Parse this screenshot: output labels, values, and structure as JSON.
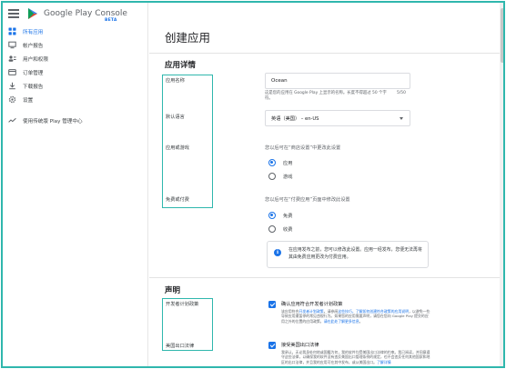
{
  "sidebar": {
    "brand": "Google Play Console",
    "beta": "BETA",
    "items": [
      {
        "label": "所有应用",
        "icon": "apps-icon",
        "active": true
      },
      {
        "label": "帐户报告",
        "icon": "monitor-icon",
        "active": false
      },
      {
        "label": "用户和权限",
        "icon": "users-icon",
        "active": false
      },
      {
        "label": "订单管理",
        "icon": "card-icon",
        "active": false
      },
      {
        "label": "下载报告",
        "icon": "download-icon",
        "active": false
      },
      {
        "label": "设置",
        "icon": "gear-icon",
        "active": false
      },
      {
        "label": "使用传统版 Play 管理中心",
        "icon": "trend-icon",
        "active": false
      }
    ]
  },
  "page": {
    "title": "创建应用"
  },
  "details": {
    "section_title": "应用详情",
    "name_label": "应用名称",
    "name_value": "Ocean",
    "name_help": "这是您的应用在 Google Play 上显示的名称。长度不得超过 50 个字符。",
    "name_counter": "5/50",
    "lang_label": "默认语言",
    "lang_value": "英语（美国） – en-US",
    "type_label": "应用或游戏",
    "type_hint": "您以后可在“商店设置”中更改此设置",
    "type_options": [
      "应用",
      "游戏"
    ],
    "type_selected": 0,
    "price_label": "免费或付费",
    "price_hint": "您以后可在“付费应用”页面中修改此设置",
    "price_options": [
      "免费",
      "收费"
    ],
    "price_selected": 0,
    "info_text": "在应用发布之前，您可以修改此设置。应用一经发布，您便无法再将其由免费应用更改为付费应用。"
  },
  "declarations": {
    "section_title": "声明",
    "dev_label": "开发者计划政策",
    "dev_title": "确认应用符合开发者计划政策",
    "dev_text_1": "该应用符合",
    "dev_link_1": "开发者计划政策",
    "dev_text_2": "。请参阅",
    "dev_link_2": "这些技巧",
    "dev_text_3": "，了解如何创建符合政策的应用说明",
    "dev_text_4": "，以避免一些导致应用遭暂停的常见违规行为。如果您的应用需要声明，请您在您向 Google Play 提交的应用之外的位置的应用政策，",
    "dev_link_3": "请在此处了解更多信息",
    "dev_text_5": "。",
    "export_label": "美国出口法律",
    "export_title": "接受美国出口法律",
    "export_text": "我承认，无论我身处何地或国籍为何，我的软件均受美国出口法律的约束。我已阅读，并同意遵守这些法律，以确保我的软件没有违反美国出口管理条例的规定，也不会违反任何其他国家和地区的出口法律，并且我的应用可在其中发布，或从美国出口。",
    "export_link": "了解详情"
  },
  "colors": {
    "accent": "#1a73e8",
    "highlight": "#2fb7ad"
  }
}
